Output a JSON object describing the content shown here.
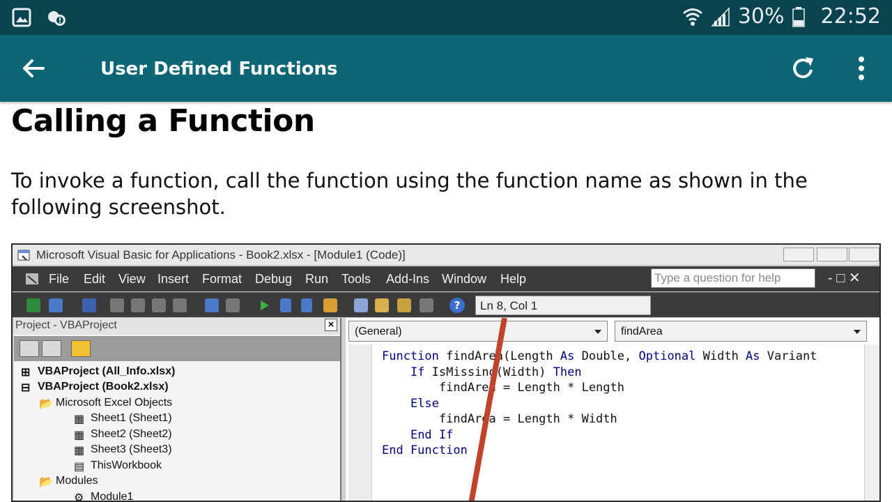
{
  "status_bar": {
    "battery": "30%",
    "time": "22:52",
    "icons": [
      "image-icon",
      "weather-alert-icon",
      "wifi-icon",
      "signal-icon",
      "battery-icon"
    ]
  },
  "app_bar": {
    "title": "User Defined Functions",
    "icons": [
      "back-arrow-icon",
      "refresh-icon",
      "more-vert-icon"
    ],
    "color": "#0c6675"
  },
  "article": {
    "heading": "Calling a Function",
    "paragraph": "To invoke a function, call the function using the function name as shown in the following screenshot."
  },
  "vba_window": {
    "title": "Microsoft Visual Basic for Applications - Book2.xlsx - [Module1 (Code)]",
    "menu": [
      "File",
      "Edit",
      "View",
      "Insert",
      "Format",
      "Debug",
      "Run",
      "Tools",
      "Add-Ins",
      "Window",
      "Help"
    ],
    "help_placeholder": "Type a question for help",
    "position": "Ln 8, Col 1",
    "project_title": "Project - VBAProject",
    "tree": [
      "VBAProject (All_Info.xlsx)",
      "VBAProject (Book2.xlsx)",
      "Microsoft Excel Objects",
      "Sheet1 (Sheet1)",
      "Sheet2 (Sheet2)",
      "Sheet3 (Sheet3)",
      "ThisWorkbook",
      "Modules",
      "Module1"
    ],
    "object_combo": "(General)",
    "procedure_combo": "findArea",
    "code": {
      "l1_kw1": "Function",
      "l1_rest": " findArea(Length ",
      "l1_kw2": "As",
      "l1_mid": " Double, ",
      "l1_kw3": "Optional",
      "l1_mid2": " Width ",
      "l1_kw4": "As",
      "l1_end": " Variant",
      "l2_kw1": "If",
      "l2_rest": " IsMissing(Width) ",
      "l2_kw2": "Then",
      "l3": "findArea = Length * Length",
      "l4_kw": "Else",
      "l5": "findArea = Length * Width",
      "l6_kw": "End If",
      "l7_kw": "End Function"
    }
  }
}
